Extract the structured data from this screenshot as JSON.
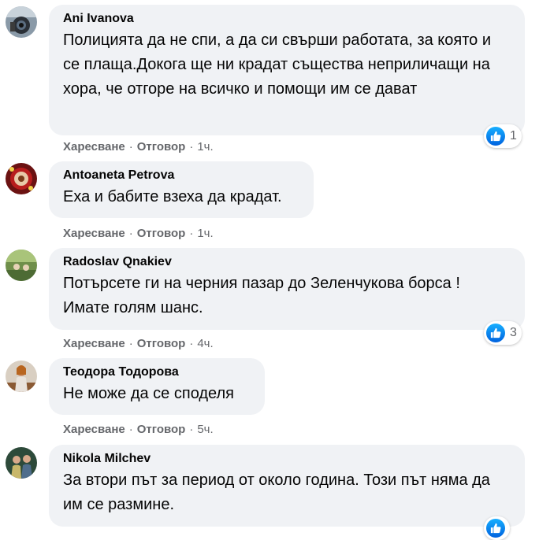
{
  "comments": [
    {
      "author": "Ani Ivanova",
      "text": "Полицията да не спи, а да си свърши работата, за която и се плаща.Докога ще ни крадат същества неприличащи на хора, че отгоре на всичко и помощи им се дават",
      "like_label": "Харесване",
      "reply_label": "Отговор",
      "time": "1ч.",
      "reaction_count": "1"
    },
    {
      "author": "Antoaneta Petrova",
      "text": "Еха и бабите взеха да крадат.",
      "like_label": "Харесване",
      "reply_label": "Отговор",
      "time": "1ч."
    },
    {
      "author": "Radoslav Qnakiev",
      "text": "Потърсете ги на черния пазар до Зеленчукова борса ! Имате голям шанс.",
      "like_label": "Харесване",
      "reply_label": "Отговор",
      "time": "4ч.",
      "reaction_count": "3"
    },
    {
      "author": "Теодора Тодорова",
      "text": "Не може да се споделя",
      "like_label": "Харесване",
      "reply_label": "Отговор",
      "time": "5ч."
    },
    {
      "author": "Nikola Milchev",
      "text": "За втори път за период от около година. Този път няма да им се размине."
    }
  ],
  "separator": "·",
  "colors": {
    "bubble": "#f0f2f5",
    "meta_text": "#65676b",
    "like_blue": "#1877f2"
  }
}
